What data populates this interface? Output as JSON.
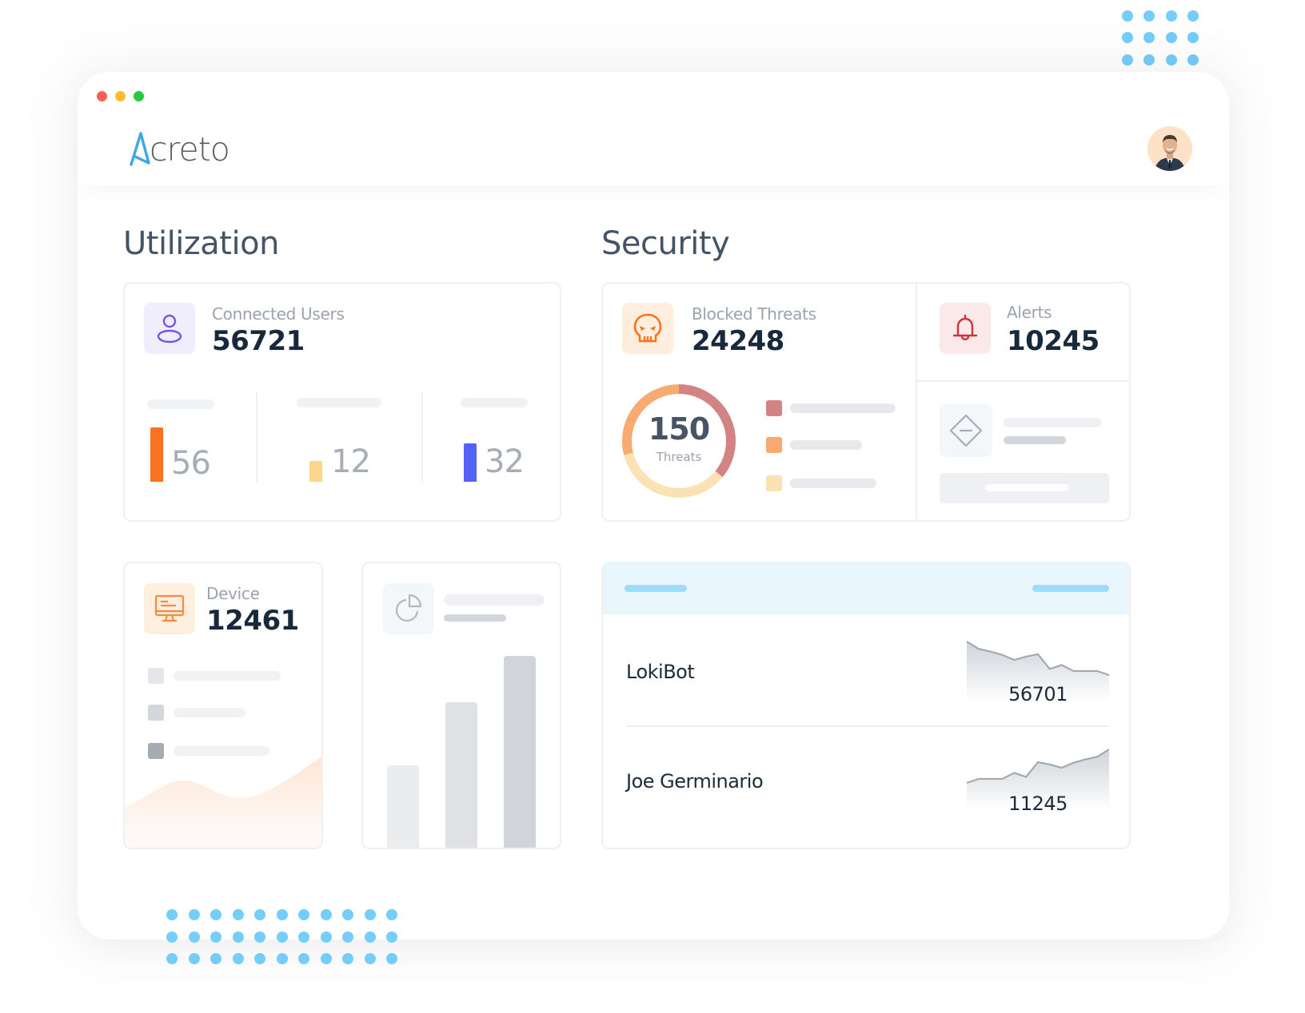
{
  "window": {
    "traffic_lights": [
      "close",
      "minimize",
      "maximize"
    ]
  },
  "header": {
    "logo_mark": "A",
    "logo_text": "creto",
    "avatar_icon": "user-avatar-photo"
  },
  "utilization": {
    "title": "Utilization",
    "connected_users": {
      "icon": "user-icon",
      "label": "Connected Users",
      "value": "56721",
      "metrics": [
        {
          "value": "56",
          "color": "#fb7320",
          "level": 1.0
        },
        {
          "value": "12",
          "color": "#fdd78c",
          "level": 0.38
        },
        {
          "value": "32",
          "color": "#5563f5",
          "level": 0.71
        }
      ]
    },
    "device": {
      "icon": "monitor-icon",
      "label": "Device",
      "value": "12461",
      "legend_colors": [
        "#e4e6e9",
        "#d3d6da",
        "#a5acb3"
      ]
    },
    "bar_card": {
      "icon": "pie-chart-icon",
      "bars": [
        0.43,
        0.76,
        1.0
      ],
      "bar_colors": [
        "#ebecee",
        "#dfe1e4",
        "#d1d4d8"
      ]
    }
  },
  "security": {
    "title": "Security",
    "blocked_threats": {
      "icon": "skull-icon",
      "label": "Blocked Threats",
      "value": "24248",
      "donut": {
        "center_value": "150",
        "center_label": "Threats",
        "segments": [
          {
            "share": 0.36,
            "color": "#d48385"
          },
          {
            "share": 0.35,
            "color": "#fbe2b4"
          },
          {
            "share": 0.29,
            "color": "#f9aa70"
          }
        ]
      },
      "legend_colors": [
        "#d48385",
        "#f9aa70",
        "#fbe2b4"
      ]
    },
    "alerts": {
      "icon": "bell-icon",
      "label": "Alerts",
      "value": "10245",
      "sub_icon": "diamond-minus-icon"
    },
    "top_threats_table": {
      "rows": [
        {
          "name": "LokiBot",
          "value": "56701",
          "trend": [
            1.0,
            0.78,
            0.7,
            0.6,
            0.45,
            0.55,
            0.62,
            0.18,
            0.3,
            0.12,
            0.12,
            0.12,
            0.0
          ]
        },
        {
          "name": "Joe Germinario",
          "value": "11245",
          "trend": [
            0.0,
            0.12,
            0.12,
            0.12,
            0.3,
            0.18,
            0.62,
            0.55,
            0.45,
            0.6,
            0.7,
            0.78,
            1.0
          ]
        }
      ]
    }
  }
}
